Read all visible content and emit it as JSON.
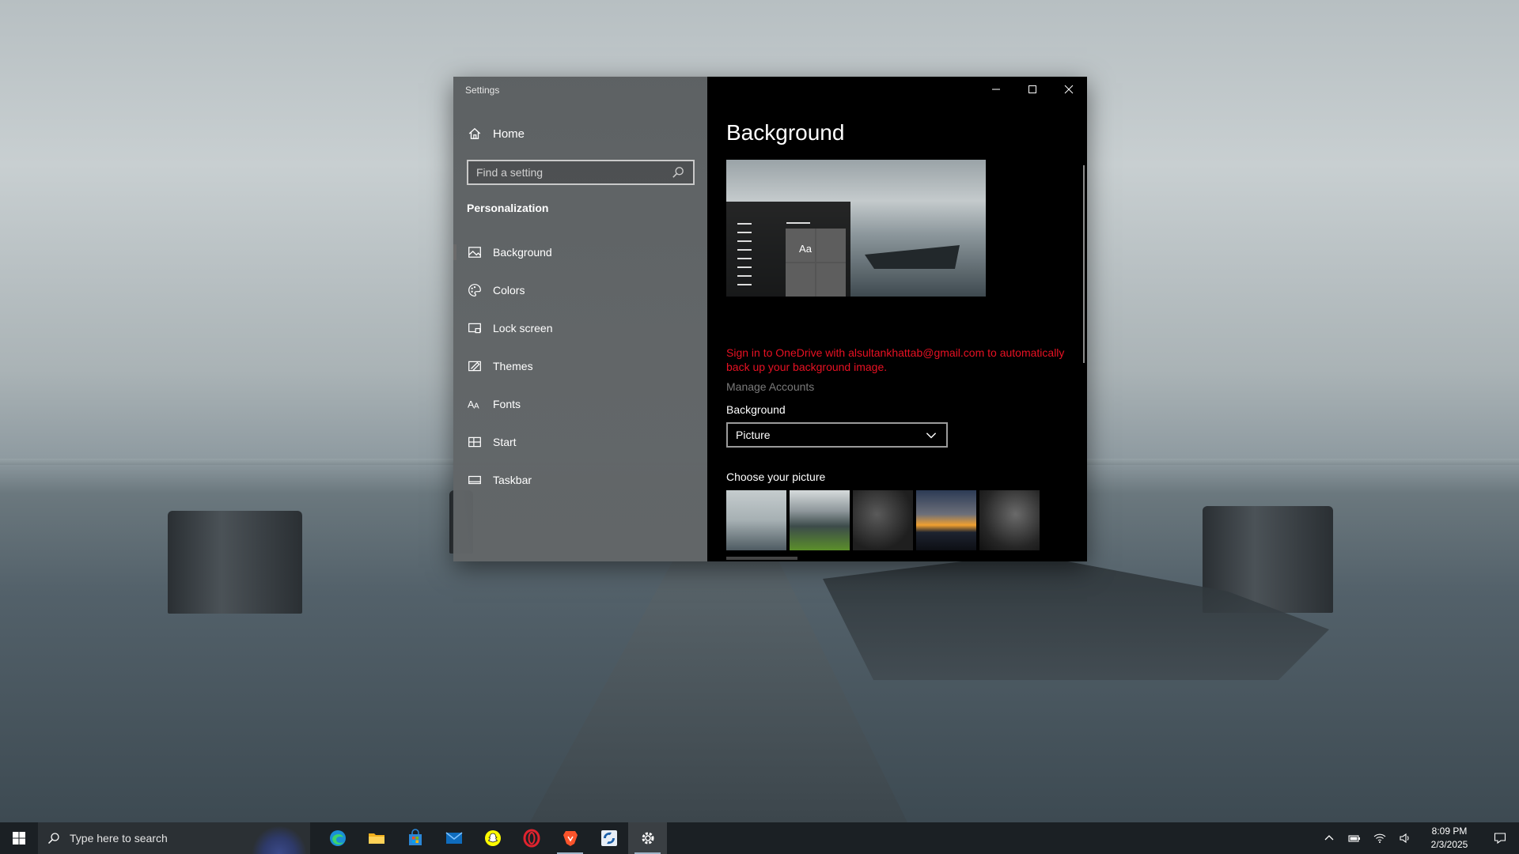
{
  "window": {
    "app_title": "Settings",
    "minimize_icon": "minimize-icon",
    "maximize_icon": "maximize-icon",
    "close_icon": "close-icon"
  },
  "sidebar": {
    "home_label": "Home",
    "search_placeholder": "Find a setting",
    "section_title": "Personalization",
    "items": [
      {
        "label": "Background",
        "icon": "picture-icon",
        "active": true
      },
      {
        "label": "Colors",
        "icon": "palette-icon"
      },
      {
        "label": "Lock screen",
        "icon": "lock-screen-icon"
      },
      {
        "label": "Themes",
        "icon": "themes-icon"
      },
      {
        "label": "Fonts",
        "icon": "fonts-icon"
      },
      {
        "label": "Start",
        "icon": "start-icon"
      },
      {
        "label": "Taskbar",
        "icon": "taskbar-icon"
      }
    ]
  },
  "content": {
    "page_title": "Background",
    "preview_tile_text": "Aa",
    "onedrive_message": "Sign in to OneDrive with alsultankhattab@gmail.com to automatically back up your background image.",
    "manage_accounts": "Manage Accounts",
    "background_label": "Background",
    "background_value": "Picture",
    "choose_picture_label": "Choose your picture",
    "error_color": "#e81123"
  },
  "taskbar": {
    "search_placeholder": "Type here to search",
    "apps": [
      {
        "name": "edge-icon"
      },
      {
        "name": "file-explorer-icon"
      },
      {
        "name": "microsoft-store-icon"
      },
      {
        "name": "mail-icon"
      },
      {
        "name": "snapchat-icon"
      },
      {
        "name": "opera-icon"
      },
      {
        "name": "brave-icon"
      },
      {
        "name": "app-icon"
      },
      {
        "name": "settings-icon",
        "active": true
      }
    ],
    "time": "8:09 PM",
    "date": "2/3/2025"
  }
}
